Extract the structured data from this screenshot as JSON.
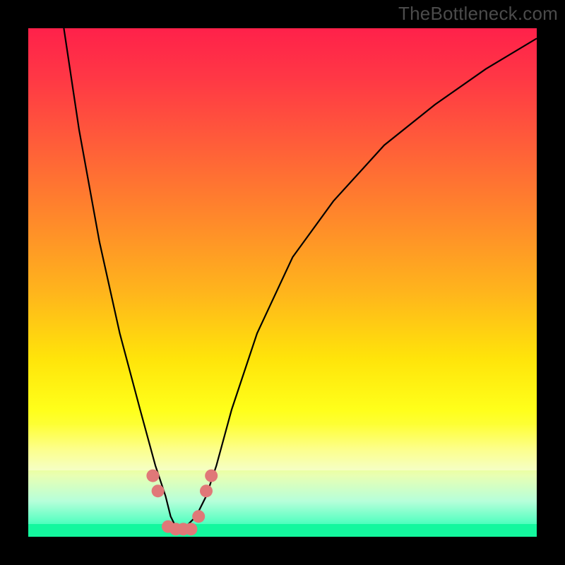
{
  "watermark": "TheBottleneck.com",
  "chart_data": {
    "type": "line",
    "title": "",
    "xlabel": "",
    "ylabel": "",
    "xlim": [
      0,
      100
    ],
    "ylim": [
      0,
      100
    ],
    "grid": false,
    "legend": false,
    "background_gradient": {
      "direction": "vertical",
      "stops": [
        {
          "pos": 0.0,
          "color": "#ff214a"
        },
        {
          "pos": 0.22,
          "color": "#ff5b3a"
        },
        {
          "pos": 0.52,
          "color": "#ffb51c"
        },
        {
          "pos": 0.75,
          "color": "#ffff1a"
        },
        {
          "pos": 0.93,
          "color": "#b6ffda"
        },
        {
          "pos": 1.0,
          "color": "#14f79e"
        }
      ]
    },
    "series": [
      {
        "name": "bottleneck-curve",
        "color": "#000000",
        "x": [
          7,
          10,
          14,
          18,
          22,
          25,
          27,
          28,
          29,
          30,
          31,
          33,
          35,
          37,
          40,
          45,
          52,
          60,
          70,
          80,
          90,
          100
        ],
        "y": [
          100,
          80,
          58,
          40,
          25,
          14,
          8,
          4,
          2,
          1,
          2,
          4,
          8,
          14,
          25,
          40,
          55,
          66,
          77,
          85,
          92,
          98
        ]
      }
    ],
    "markers": {
      "color": "#e07878",
      "radius_px": 9,
      "points": [
        {
          "x": 24.5,
          "y": 12
        },
        {
          "x": 25.5,
          "y": 9
        },
        {
          "x": 27.5,
          "y": 2
        },
        {
          "x": 29.0,
          "y": 1.5
        },
        {
          "x": 30.5,
          "y": 1.5
        },
        {
          "x": 32.0,
          "y": 1.5
        },
        {
          "x": 33.5,
          "y": 4
        },
        {
          "x": 35.0,
          "y": 9
        },
        {
          "x": 36.0,
          "y": 12
        }
      ]
    }
  }
}
